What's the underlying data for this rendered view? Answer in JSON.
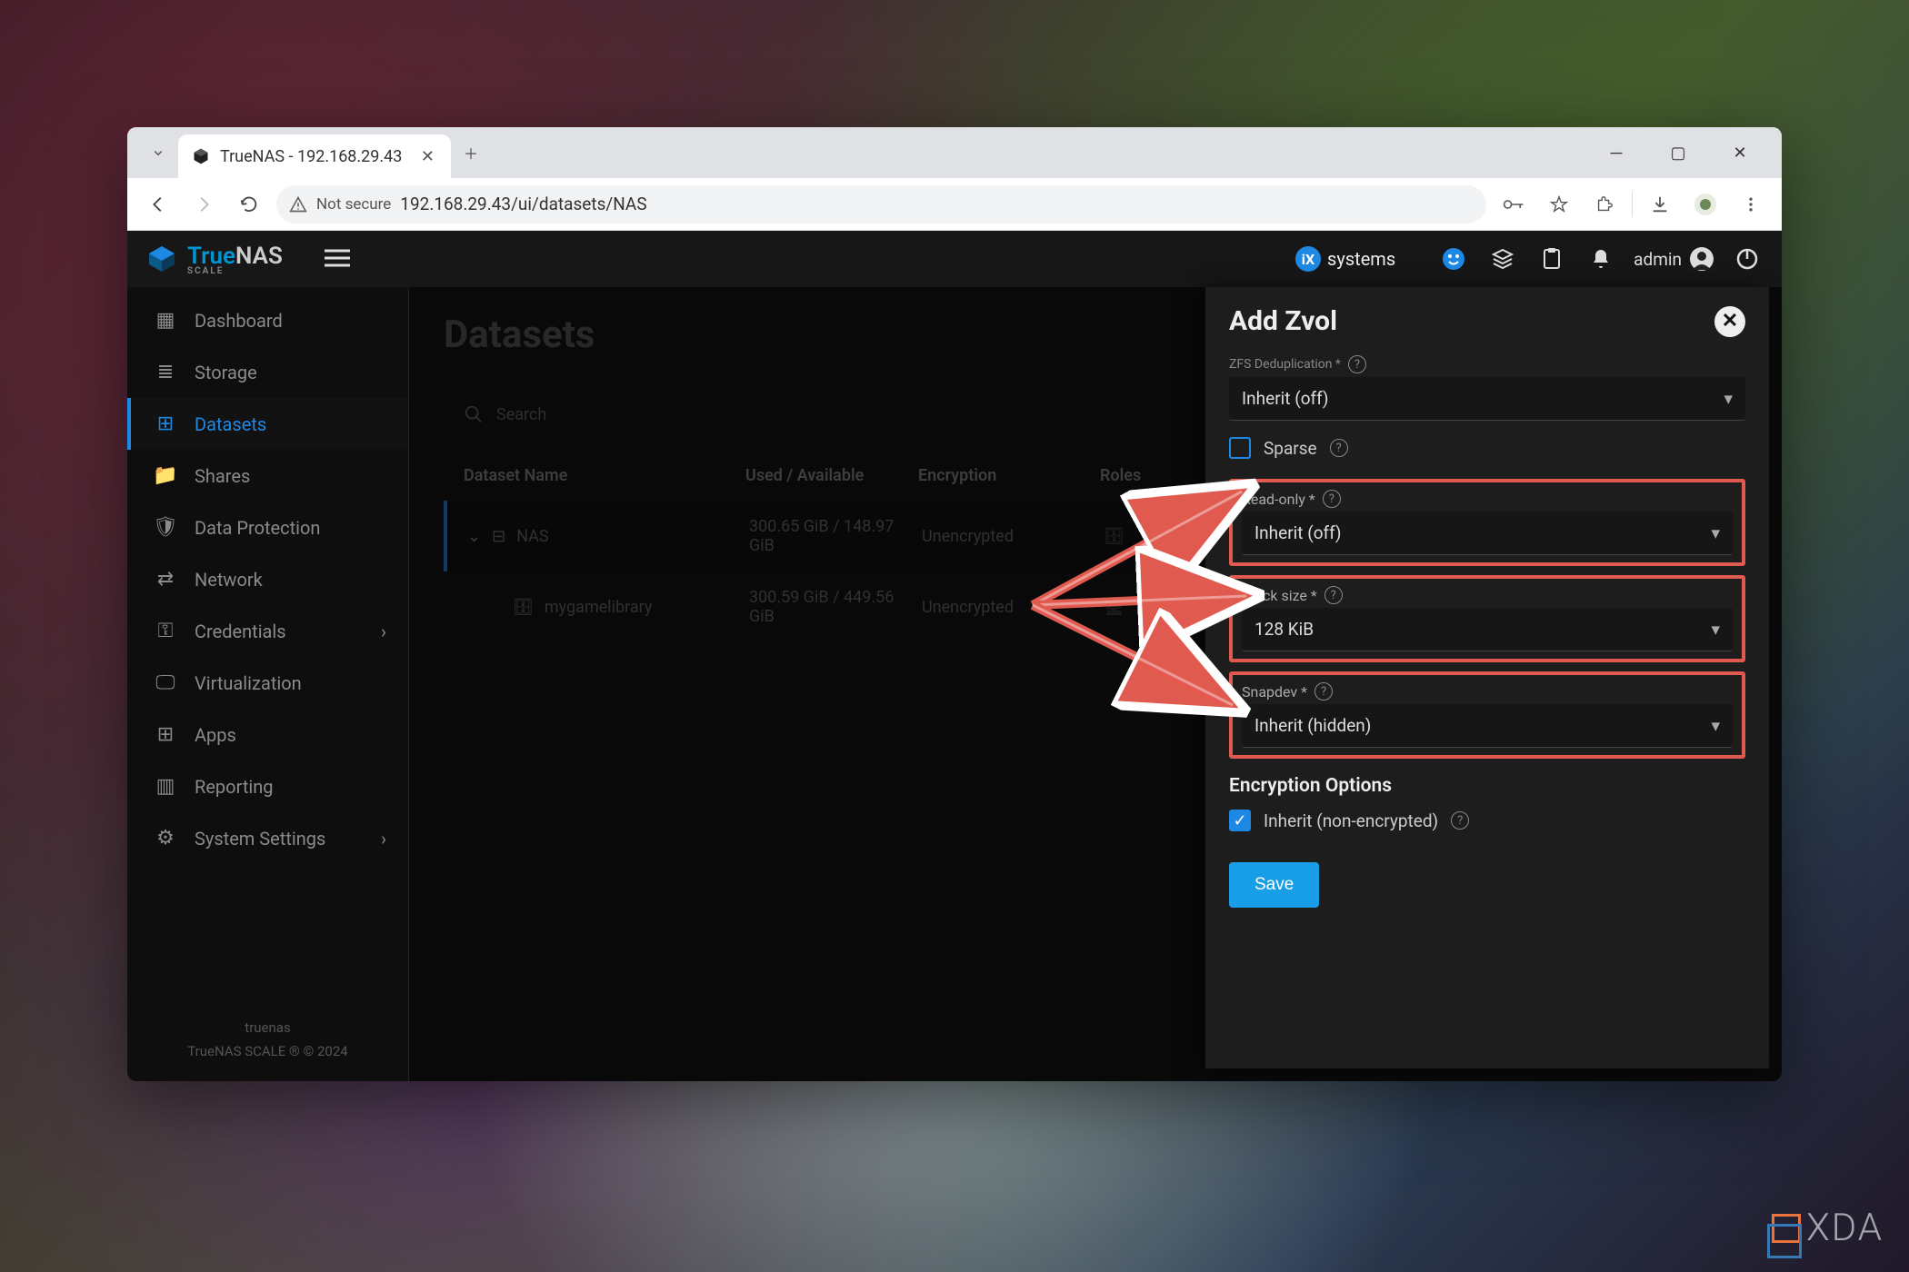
{
  "browser_tab": {
    "title": "TrueNAS - 192.168.29.43"
  },
  "address_bar": {
    "security": "Not secure",
    "url": "192.168.29.43/ui/datasets/NAS"
  },
  "brand": {
    "name1": "True",
    "name2": "NAS",
    "sub": "SCALE"
  },
  "ix": "systems",
  "admin_label": "admin",
  "sidebar": {
    "items": [
      {
        "label": "Dashboard"
      },
      {
        "label": "Storage"
      },
      {
        "label": "Datasets"
      },
      {
        "label": "Shares"
      },
      {
        "label": "Data Protection"
      },
      {
        "label": "Network"
      },
      {
        "label": "Credentials"
      },
      {
        "label": "Virtualization"
      },
      {
        "label": "Apps"
      },
      {
        "label": "Reporting"
      },
      {
        "label": "System Settings"
      }
    ],
    "footer": {
      "host": "truenas",
      "copyright": "TrueNAS SCALE ® © 2024"
    }
  },
  "page": {
    "title": "Datasets",
    "search_placeholder": "Search"
  },
  "table": {
    "headers": {
      "name": "Dataset Name",
      "used": "Used / Available",
      "enc": "Encryption",
      "roles": "Roles"
    },
    "rows": [
      {
        "name": "NAS",
        "used": "300.65 GiB / 148.97 GiB",
        "enc": "Unencrypted",
        "roles": ""
      },
      {
        "name": "mygamelibrary",
        "used": "300.59 GiB / 449.56 GiB",
        "enc": "Unencrypted",
        "roles": ""
      }
    ]
  },
  "drawer": {
    "title": "Add Zvol",
    "fields": {
      "dedup_label": "ZFS Deduplication *",
      "dedup_value": "Inherit (off)",
      "sparse_label": "Sparse",
      "readonly_label": "Read-only *",
      "readonly_value": "Inherit (off)",
      "blocksize_label": "Block size *",
      "blocksize_value": "128 KiB",
      "snapdev_label": "Snapdev *",
      "snapdev_value": "Inherit (hidden)",
      "enc_section": "Encryption Options",
      "inherit_enc_label": "Inherit (non-encrypted)",
      "save": "Save"
    }
  },
  "watermark": "XDA"
}
